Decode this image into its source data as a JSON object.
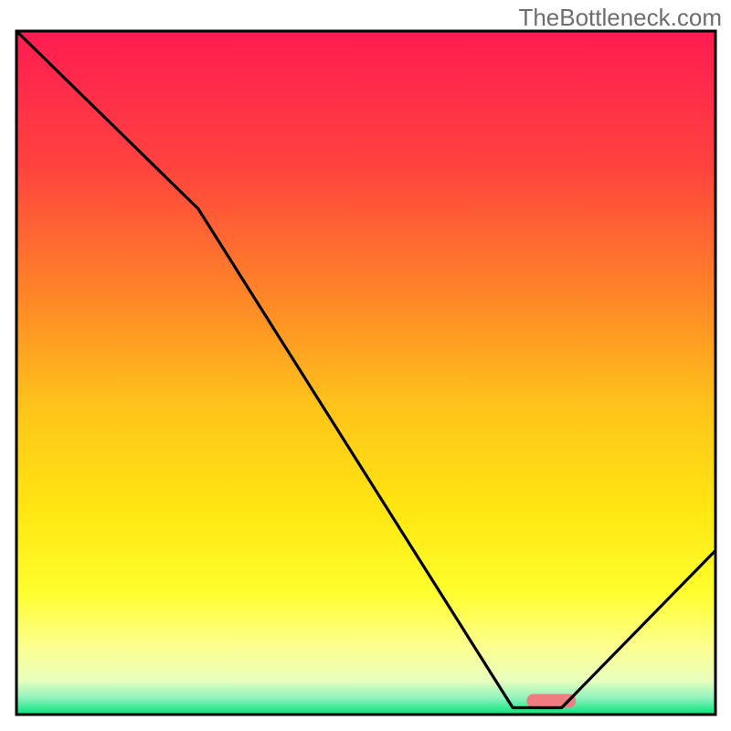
{
  "watermark_text": "TheBottleneck.com",
  "chart_data": {
    "type": "line",
    "title": "",
    "xlabel": "",
    "ylabel": "",
    "xlim": [
      0,
      100
    ],
    "ylim": [
      0,
      100
    ],
    "grid": false,
    "background": "rainbow-gradient",
    "series": [
      {
        "name": "curve",
        "x": [
          0,
          26,
          71,
          78,
          100
        ],
        "y": [
          100,
          74,
          1,
          1,
          24
        ]
      }
    ],
    "highlight_bar": {
      "x_start": 73,
      "x_end": 80,
      "y": 2,
      "color": "#ee7c80"
    },
    "gradient_stops": [
      {
        "pos": 0.0,
        "color": "#ff1c52"
      },
      {
        "pos": 0.2,
        "color": "#ff433e"
      },
      {
        "pos": 0.4,
        "color": "#ff8a26"
      },
      {
        "pos": 0.55,
        "color": "#ffc41a"
      },
      {
        "pos": 0.7,
        "color": "#ffe611"
      },
      {
        "pos": 0.82,
        "color": "#fefe2c"
      },
      {
        "pos": 0.9,
        "color": "#fdff8e"
      },
      {
        "pos": 0.95,
        "color": "#e8ffbd"
      },
      {
        "pos": 0.975,
        "color": "#93f2be"
      },
      {
        "pos": 1.0,
        "color": "#00e57a"
      }
    ],
    "axis_color": "#000000",
    "line_color": "#000000",
    "line_width": 3.2
  }
}
